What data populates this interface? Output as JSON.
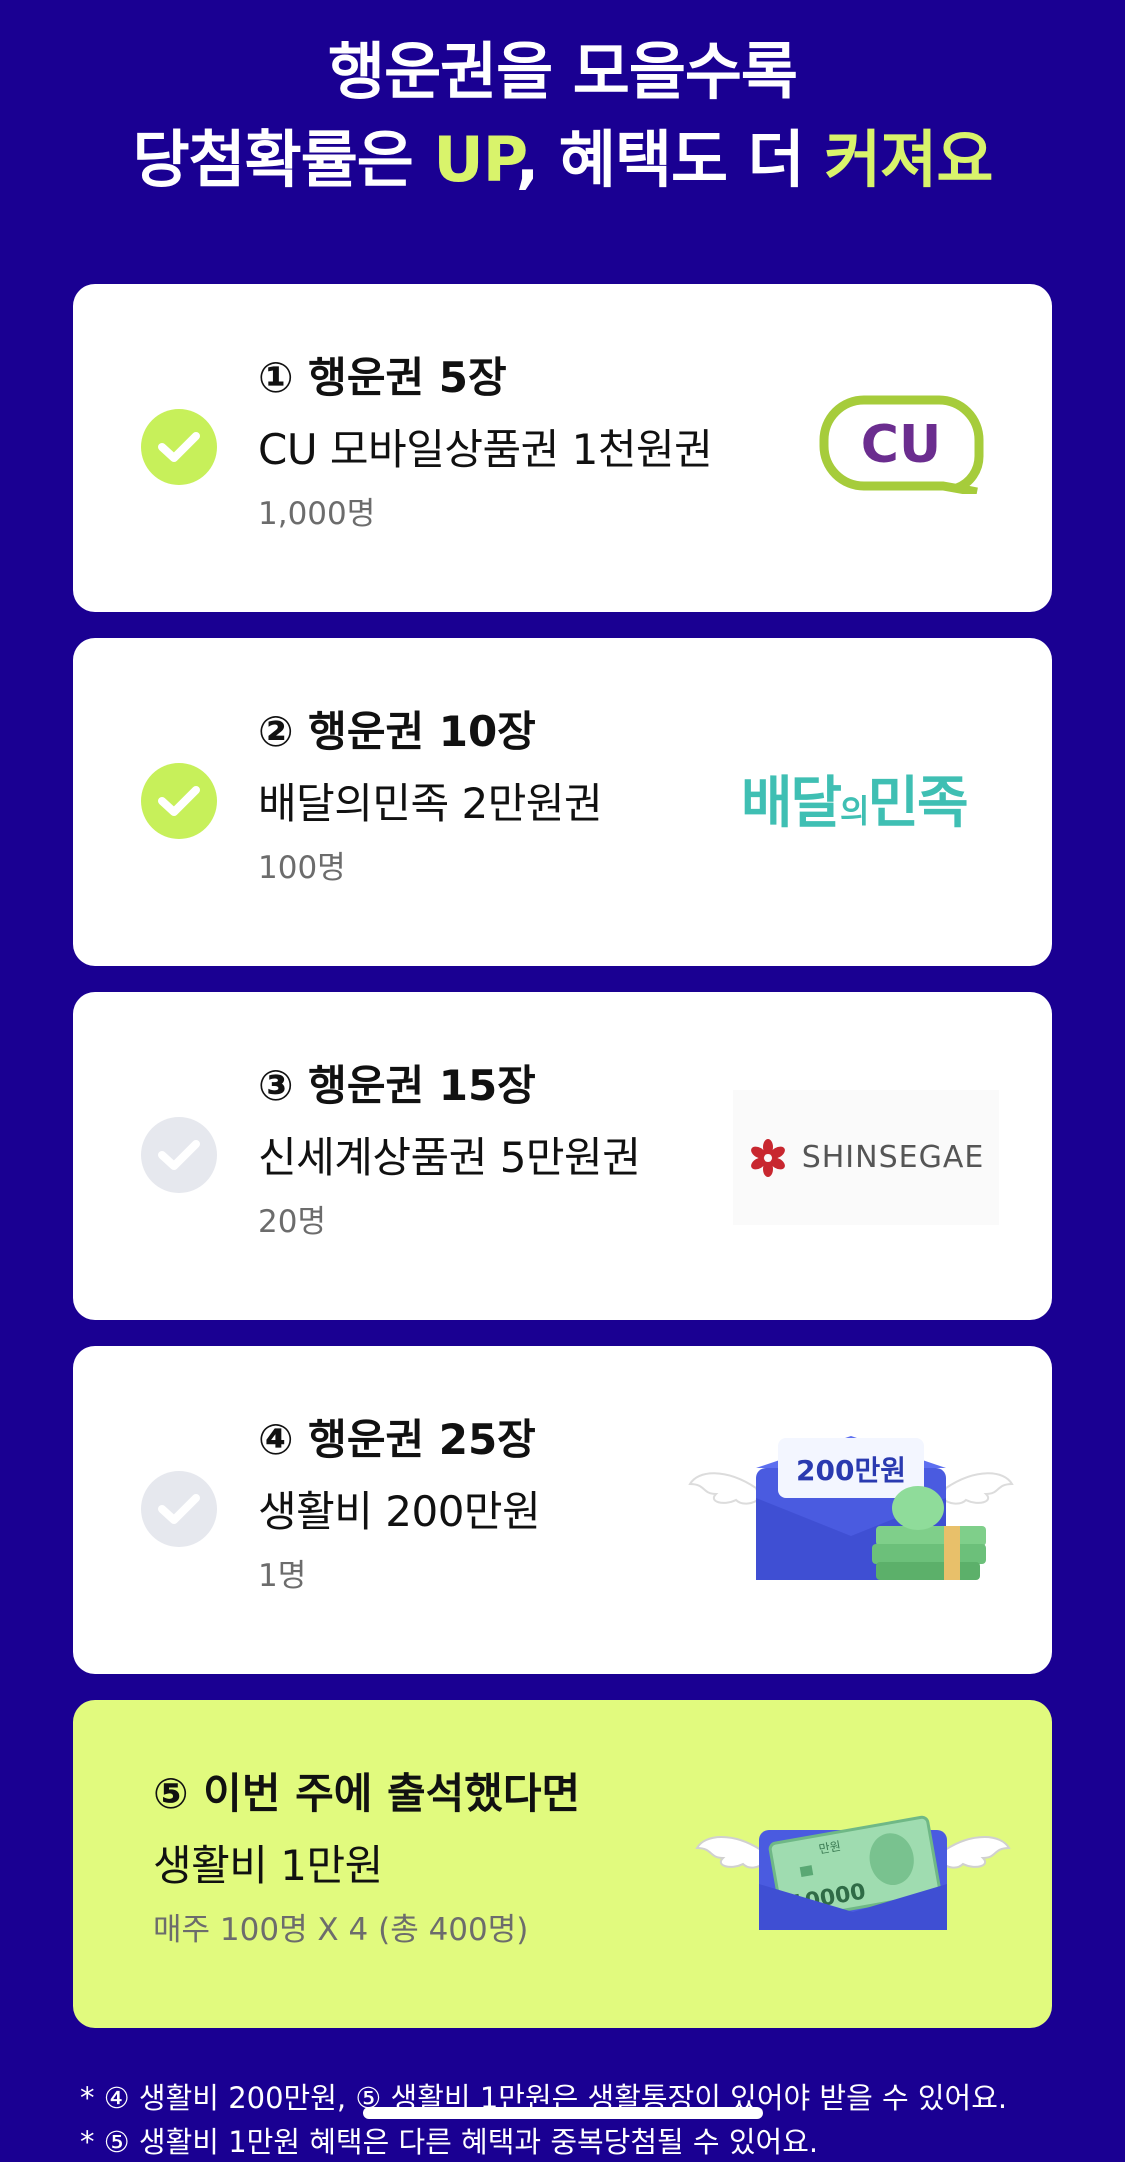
{
  "headline": {
    "line1": "행운권을 모을수록",
    "line2_a": "당첨확률은 ",
    "line2_b": "UP",
    "line2_c": ", 혜택도 더 ",
    "line2_d": "커져요"
  },
  "colors": {
    "background": "#1a0092",
    "accent": "#d9f36b",
    "check_on": "#c7f05a",
    "check_off": "#e6e8ee",
    "highlight_card": "#e1fa7e"
  },
  "rewards": [
    {
      "title": "① 행운권 5장",
      "prize": "CU 모바일상품권 1천원권",
      "count": "1,000명",
      "checked": true,
      "logo_text": "CU",
      "icon": "cu-logo"
    },
    {
      "title": "② 행운권 10장",
      "prize": "배달의민족 2만원권",
      "count": "100명",
      "checked": true,
      "logo_text_a": "배달",
      "logo_text_b": "의",
      "logo_text_c": "민족",
      "icon": "baemin-logo"
    },
    {
      "title": "③ 행운권 15장",
      "prize": "신세계상품권 5만원권",
      "count": "20명",
      "checked": false,
      "logo_text": "SHINSEGAE",
      "icon": "shinsegae-logo"
    },
    {
      "title": "④ 행운권 25장",
      "prize": "생활비 200만원",
      "count": "1명",
      "checked": false,
      "badge_text": "200만원",
      "icon": "winged-envelope-money-icon"
    },
    {
      "title": "⑤ 이번 주에 출석했다면",
      "prize": "생활비 1만원",
      "count": "매주 100명 X 4 (총 400명)",
      "banknote_text": "10000",
      "banknote_small": "만원",
      "icon": "winged-envelope-banknote-icon"
    }
  ],
  "footnotes": [
    "* ④ 생활비 200만원, ⑤ 생활비 1만원은 생활통장이 있어야 받을 수 있어요.",
    "* ⑤ 생활비 1만원 혜택은 다른 혜택과 중복당첨될 수 있어요."
  ]
}
